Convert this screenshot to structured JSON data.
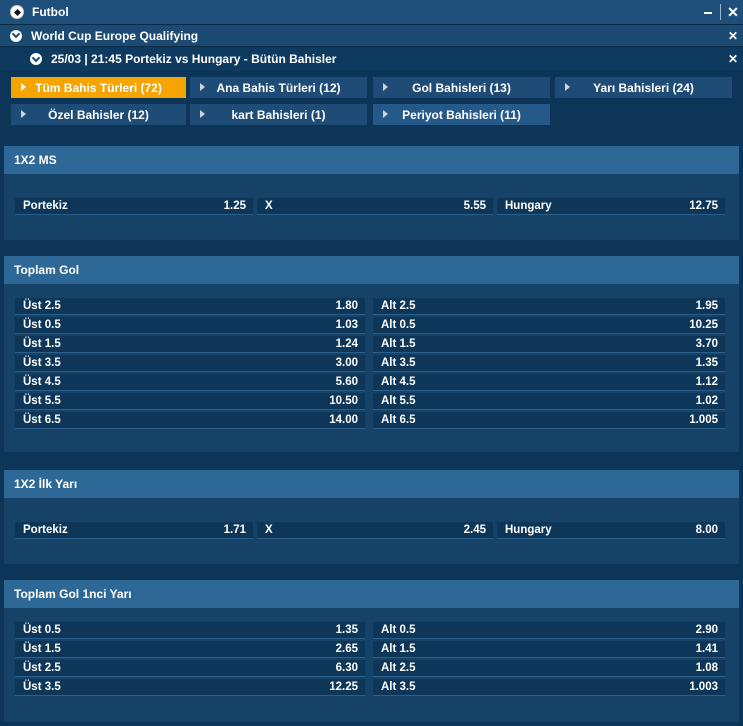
{
  "header": {
    "title": "Futbol"
  },
  "league": {
    "title": "World Cup Europe Qualifying"
  },
  "match": {
    "title": "25/03 | 21:45 Portekiz vs Hungary - Bütün Bahisler"
  },
  "tabs": [
    {
      "label": "Tüm Bahis Türleri (72)",
      "active": true
    },
    {
      "label": "Ana Bahis Türleri (12)",
      "active": false
    },
    {
      "label": "Gol Bahisleri (13)",
      "active": false
    },
    {
      "label": "Yarı Bahisleri (24)",
      "active": false
    },
    {
      "label": "Özel Bahisler (12)",
      "active": false
    },
    {
      "label": "kart Bahisleri (1)",
      "active": false
    },
    {
      "label": "Periyot Bahisleri (11)",
      "active": false
    }
  ],
  "markets": {
    "ms": {
      "title": "1X2 MS",
      "home": {
        "label": "Portekiz",
        "odd": "1.25"
      },
      "draw": {
        "label": "X",
        "odd": "5.55"
      },
      "away": {
        "label": "Hungary",
        "odd": "12.75"
      }
    },
    "toplam_gol": {
      "title": "Toplam Gol",
      "rows": [
        {
          "ust": "Üst 2.5",
          "ust_odd": "1.80",
          "alt": "Alt 2.5",
          "alt_odd": "1.95"
        },
        {
          "ust": "Üst 0.5",
          "ust_odd": "1.03",
          "alt": "Alt 0.5",
          "alt_odd": "10.25"
        },
        {
          "ust": "Üst 1.5",
          "ust_odd": "1.24",
          "alt": "Alt 1.5",
          "alt_odd": "3.70"
        },
        {
          "ust": "Üst 3.5",
          "ust_odd": "3.00",
          "alt": "Alt 3.5",
          "alt_odd": "1.35"
        },
        {
          "ust": "Üst 4.5",
          "ust_odd": "5.60",
          "alt": "Alt 4.5",
          "alt_odd": "1.12"
        },
        {
          "ust": "Üst 5.5",
          "ust_odd": "10.50",
          "alt": "Alt 5.5",
          "alt_odd": "1.02"
        },
        {
          "ust": "Üst 6.5",
          "ust_odd": "14.00",
          "alt": "Alt 6.5",
          "alt_odd": "1.005"
        }
      ]
    },
    "ilk_yari": {
      "title": "1X2 İlk Yarı",
      "home": {
        "label": "Portekiz",
        "odd": "1.71"
      },
      "draw": {
        "label": "X",
        "odd": "2.45"
      },
      "away": {
        "label": "Hungary",
        "odd": "8.00"
      }
    },
    "toplam_gol_ilk_yari": {
      "title": "Toplam Gol 1nci Yarı",
      "rows": [
        {
          "ust": "Üst 0.5",
          "ust_odd": "1.35",
          "alt": "Alt 0.5",
          "alt_odd": "2.90"
        },
        {
          "ust": "Üst 1.5",
          "ust_odd": "2.65",
          "alt": "Alt 1.5",
          "alt_odd": "1.41"
        },
        {
          "ust": "Üst 2.5",
          "ust_odd": "6.30",
          "alt": "Alt 2.5",
          "alt_odd": "1.08"
        },
        {
          "ust": "Üst 3.5",
          "ust_odd": "12.25",
          "alt": "Alt 3.5",
          "alt_odd": "1.003"
        }
      ]
    }
  }
}
